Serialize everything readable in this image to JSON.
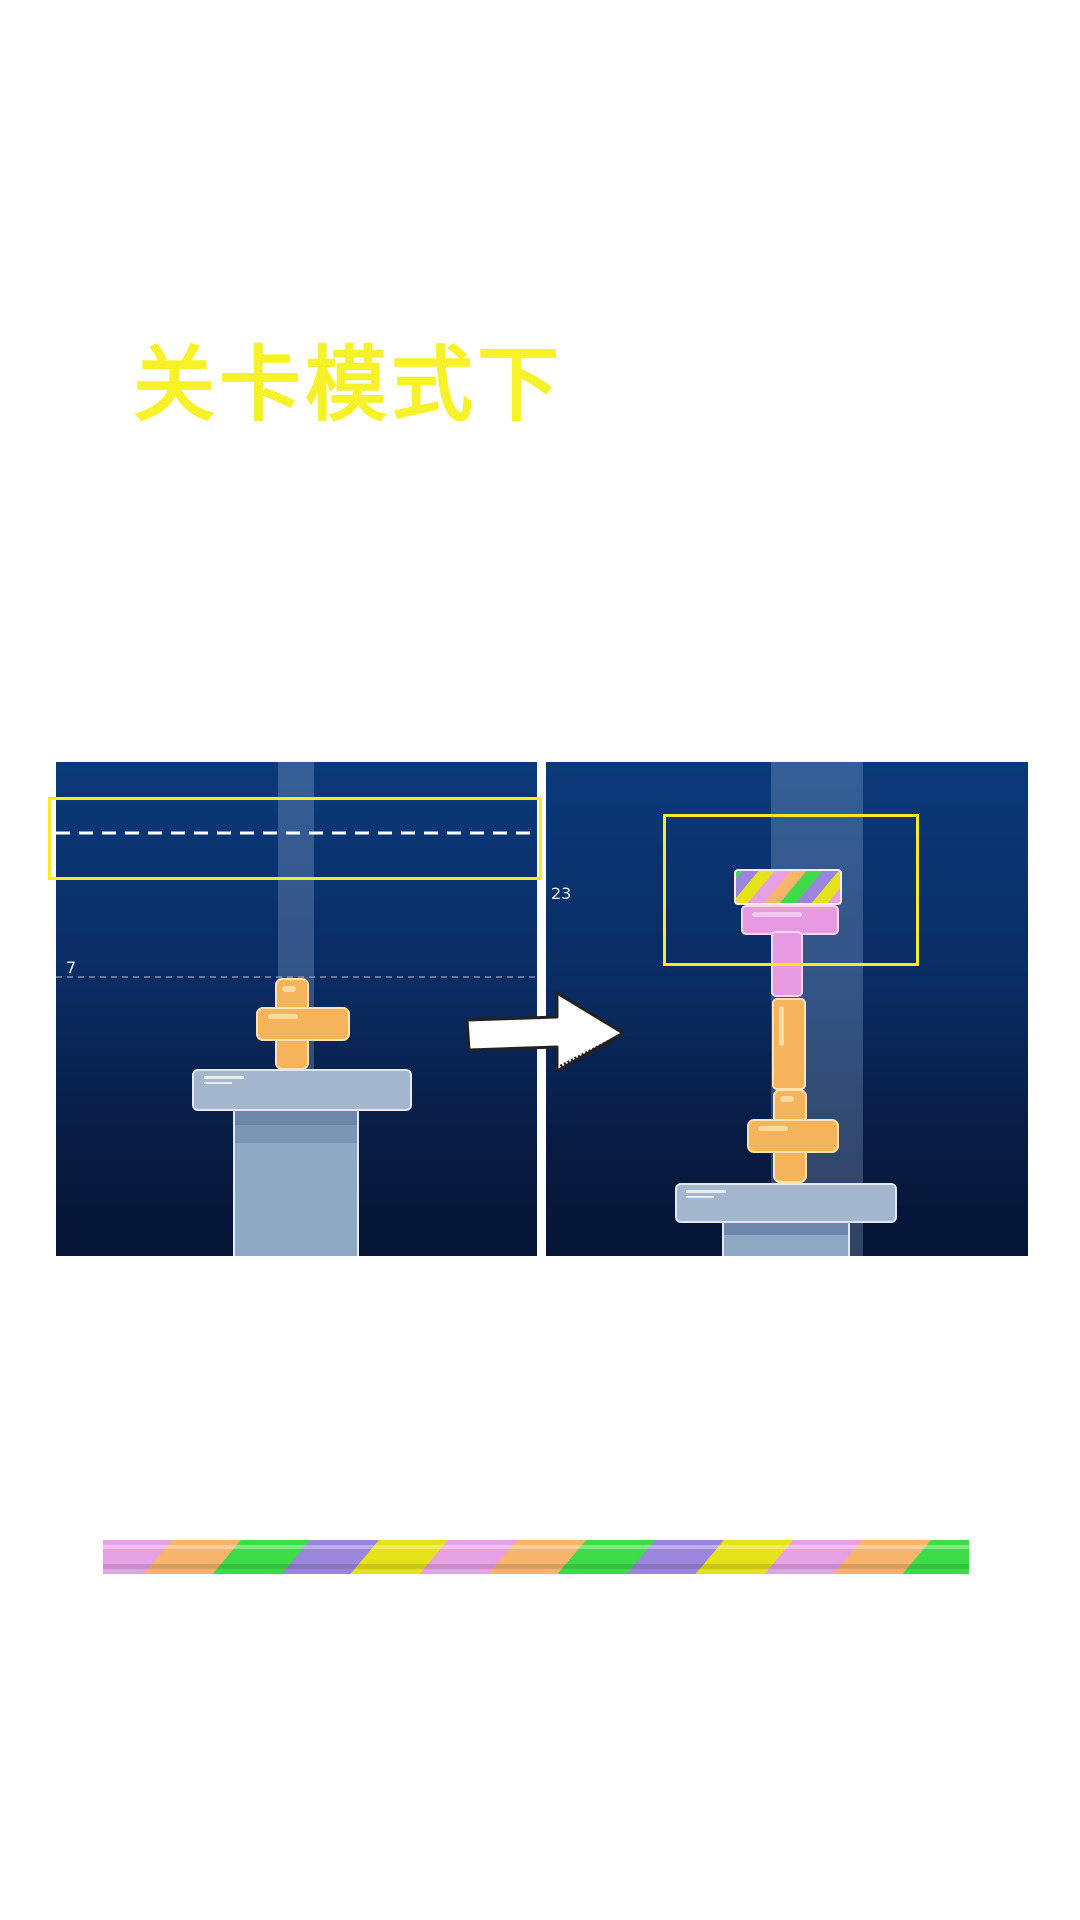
{
  "title": "关卡模式下",
  "left_panel": {
    "height_marker": "7"
  },
  "right_panel": {
    "height_marker": "23"
  },
  "colors": {
    "title": "#f7f12a",
    "highlight_box": "#f7ec26",
    "panel_top": "#0b3a7a",
    "panel_bottom": "#061536",
    "orange_block": "#f5b35c",
    "pink_block": "#e79ae0",
    "pedestal": "#9ab4cf",
    "rainbow": [
      "#e6a0e4",
      "#f7b46a",
      "#3ddc46",
      "#9a86dd",
      "#e6e21a"
    ]
  },
  "icons": [
    "right-arrow-icon"
  ]
}
